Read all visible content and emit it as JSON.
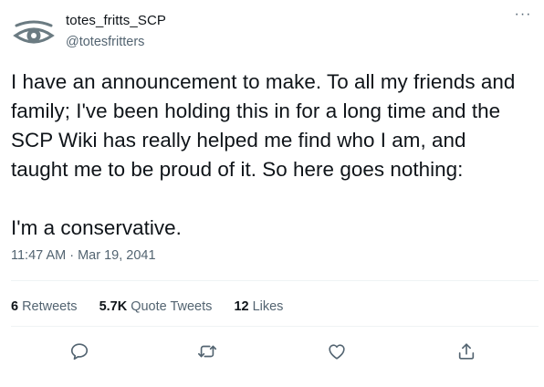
{
  "user": {
    "display_name": "totes_fritts_SCP",
    "handle": "@totesfritters",
    "avatar_icon": "eye-logo-icon"
  },
  "tweet": {
    "lines": [
      "I have an announcement to make. To all my friends and",
      "family; I've been holding this in for a long time and the",
      "SCP Wiki has really helped me find who I am, and",
      "taught me to be proud of it. So here goes nothing:"
    ],
    "line2": "I'm a conservative.",
    "timestamp": "11:47 AM · Mar 19, 2041"
  },
  "stats": {
    "retweets_count": "6",
    "retweets_label": "Retweets",
    "quotes_count": "5.7K",
    "quotes_label": "Quote Tweets",
    "likes_count": "12",
    "likes_label": "Likes"
  },
  "more_label": "···",
  "actions": [
    "reply-icon",
    "retweet-icon",
    "like-icon",
    "share-icon"
  ],
  "colors": {
    "text": "#0f1419",
    "secondary": "#536471",
    "divider": "#eff3f4",
    "icon": "#536471"
  }
}
